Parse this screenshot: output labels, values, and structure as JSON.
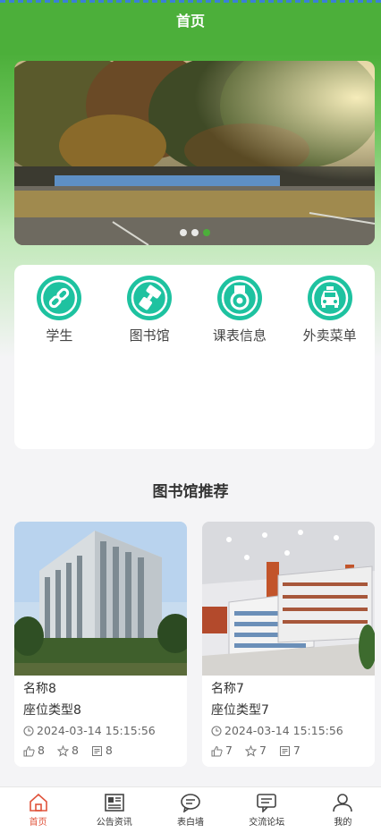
{
  "navbar": {
    "title": "首页"
  },
  "banner": {
    "dots": 3,
    "active_index": 2
  },
  "menu": [
    {
      "label": "学生",
      "icon": "link-icon"
    },
    {
      "label": "图书馆",
      "icon": "brush-icon"
    },
    {
      "label": "课表信息",
      "icon": "medal-icon"
    },
    {
      "label": "外卖菜单",
      "icon": "taxi-icon"
    }
  ],
  "section": {
    "title": "图书馆推荐"
  },
  "cards": [
    {
      "name": "名称8",
      "seat": "座位类型8",
      "time": "2024-03-14 15:15:56",
      "likes": "8",
      "favorites": "8",
      "comments": "8"
    },
    {
      "name": "名称7",
      "seat": "座位类型7",
      "time": "2024-03-14 15:15:56",
      "likes": "7",
      "favorites": "7",
      "comments": "7"
    }
  ],
  "tabbar": [
    {
      "label": "首页",
      "icon": "home-icon",
      "active": true
    },
    {
      "label": "公告资讯",
      "icon": "news-icon",
      "active": false
    },
    {
      "label": "表白墙",
      "icon": "chat-bubble-icon",
      "active": false
    },
    {
      "label": "交流论坛",
      "icon": "forum-icon",
      "active": false
    },
    {
      "label": "我的",
      "icon": "user-icon",
      "active": false
    }
  ],
  "colors": {
    "primary_green": "#4caf3a",
    "icon_teal": "#1ec2a0",
    "tab_active": "#e0533b"
  }
}
